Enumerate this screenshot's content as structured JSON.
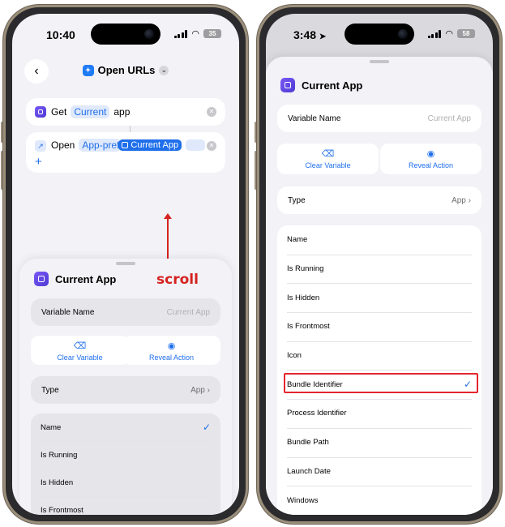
{
  "left_phone": {
    "status": {
      "time": "10:40",
      "battery": "35"
    },
    "nav": {
      "title": "Open URLs"
    },
    "action1": {
      "verb": "Get",
      "param": "Current",
      "object": "app"
    },
    "action2": {
      "verb": "Open",
      "param": "App-pref",
      "variable": "Current App",
      "add": "+"
    },
    "overlay": {
      "scroll_label": "scroll"
    },
    "sheet": {
      "title": "Current App",
      "variable_name_label": "Variable Name",
      "variable_name_placeholder": "Current App",
      "clear_label": "Clear Variable",
      "reveal_label": "Reveal Action",
      "type_label": "Type",
      "type_value": "App",
      "items": [
        {
          "label": "Name",
          "checked": true
        },
        {
          "label": "Is Running",
          "checked": false
        },
        {
          "label": "Is Hidden",
          "checked": false
        },
        {
          "label": "Is Frontmost",
          "checked": false
        }
      ]
    }
  },
  "right_phone": {
    "status": {
      "time": "3:48",
      "battery": "58"
    },
    "sheet": {
      "title": "Current App",
      "variable_name_label": "Variable Name",
      "variable_name_placeholder": "Current App",
      "clear_label": "Clear Variable",
      "reveal_label": "Reveal Action",
      "type_label": "Type",
      "type_value": "App",
      "items": [
        {
          "label": "Name",
          "checked": false
        },
        {
          "label": "Is Running",
          "checked": false
        },
        {
          "label": "Is Hidden",
          "checked": false
        },
        {
          "label": "Is Frontmost",
          "checked": false
        },
        {
          "label": "Icon",
          "checked": false
        },
        {
          "label": "Bundle Identifier",
          "checked": true
        },
        {
          "label": "Process Identifier",
          "checked": false
        },
        {
          "label": "Bundle Path",
          "checked": false
        },
        {
          "label": "Launch Date",
          "checked": false
        },
        {
          "label": "Windows",
          "checked": false
        }
      ]
    }
  },
  "colors": {
    "accent": "#1f6feb",
    "annotation_red": "#d5231f",
    "app_icon": "#5b44e0"
  }
}
